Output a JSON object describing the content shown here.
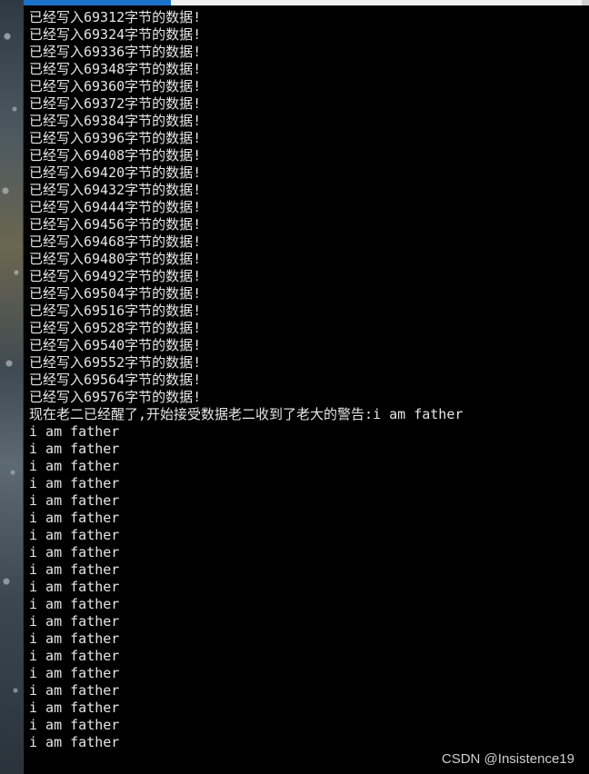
{
  "console": {
    "lines": [
      "已经写入69312字节的数据!",
      "已经写入69324字节的数据!",
      "已经写入69336字节的数据!",
      "已经写入69348字节的数据!",
      "已经写入69360字节的数据!",
      "已经写入69372字节的数据!",
      "已经写入69384字节的数据!",
      "已经写入69396字节的数据!",
      "已经写入69408字节的数据!",
      "已经写入69420字节的数据!",
      "已经写入69432字节的数据!",
      "已经写入69444字节的数据!",
      "已经写入69456字节的数据!",
      "已经写入69468字节的数据!",
      "已经写入69480字节的数据!",
      "已经写入69492字节的数据!",
      "已经写入69504字节的数据!",
      "已经写入69516字节的数据!",
      "已经写入69528字节的数据!",
      "已经写入69540字节的数据!",
      "已经写入69552字节的数据!",
      "已经写入69564字节的数据!",
      "已经写入69576字节的数据!",
      "现在老二已经醒了,开始接受数据老二收到了老大的警告:i am father",
      "i am father",
      "i am father",
      "i am father",
      "i am father",
      "i am father",
      "i am father",
      "i am father",
      "i am father",
      "i am father",
      "i am father",
      "i am father",
      "i am father",
      "i am father",
      "i am father",
      "i am father",
      "i am father",
      "i am father",
      "i am father",
      "i am father"
    ]
  },
  "watermark": "CSDN @Insistence19",
  "colors": {
    "background": "#000000",
    "text": "#e6e6e6",
    "tab_accent": "#1a73c8"
  }
}
